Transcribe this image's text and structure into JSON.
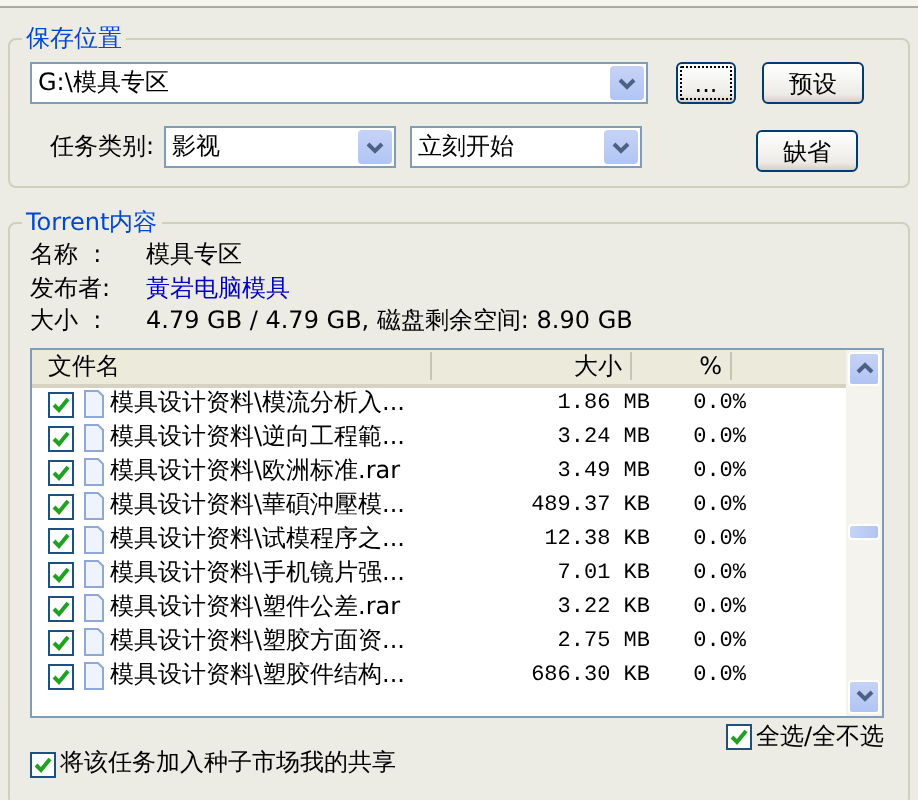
{
  "save_location": {
    "title": "保存位置",
    "path": {
      "value": "G:\\模具专区"
    },
    "browse_button": "...",
    "preset_button": "预设",
    "category_label": "任务类别:",
    "category": {
      "value": "影视"
    },
    "start_mode": {
      "value": "立刻开始"
    },
    "default_button": "缺省"
  },
  "torrent": {
    "title": "Torrent内容",
    "info": [
      {
        "label": "名称  :",
        "value": "模具专区",
        "kind": "text"
      },
      {
        "label": "发布者:",
        "value": "黃岩电脑模具",
        "kind": "link"
      },
      {
        "label": "大小  :",
        "value": "4.79 GB / 4.79 GB, 磁盘剩余空间: 8.90 GB",
        "kind": "text"
      }
    ],
    "table": {
      "columns": [
        "文件名",
        "大小",
        "%"
      ],
      "rows": [
        {
          "checked": true,
          "name": "模具设计资料\\模流分析入...",
          "size": "1.86 MB",
          "percent": "0.0%"
        },
        {
          "checked": true,
          "name": "模具设计资料\\逆向工程範...",
          "size": "3.24 MB",
          "percent": "0.0%"
        },
        {
          "checked": true,
          "name": "模具设计资料\\欧洲标准.rar",
          "size": "3.49 MB",
          "percent": "0.0%"
        },
        {
          "checked": true,
          "name": "模具设计资料\\華碩沖壓模...",
          "size": "489.37 KB",
          "percent": "0.0%"
        },
        {
          "checked": true,
          "name": "模具设计资料\\试模程序之...",
          "size": "12.38 KB",
          "percent": "0.0%"
        },
        {
          "checked": true,
          "name": "模具设计资料\\手机镜片强...",
          "size": "7.01 KB",
          "percent": "0.0%"
        },
        {
          "checked": true,
          "name": "模具设计资料\\塑件公差.rar",
          "size": "3.22 KB",
          "percent": "0.0%"
        },
        {
          "checked": true,
          "name": "模具设计资料\\塑胶方面资...",
          "size": "2.75 MB",
          "percent": "0.0%"
        },
        {
          "checked": true,
          "name": "模具设计资料\\塑胶件结构...",
          "size": "686.30 KB",
          "percent": "0.0%"
        }
      ]
    },
    "select_all": {
      "label": "全选/全不选",
      "checked": true
    }
  },
  "share": {
    "label": "将该任务加入种子市场我的共享",
    "checked": true
  }
}
